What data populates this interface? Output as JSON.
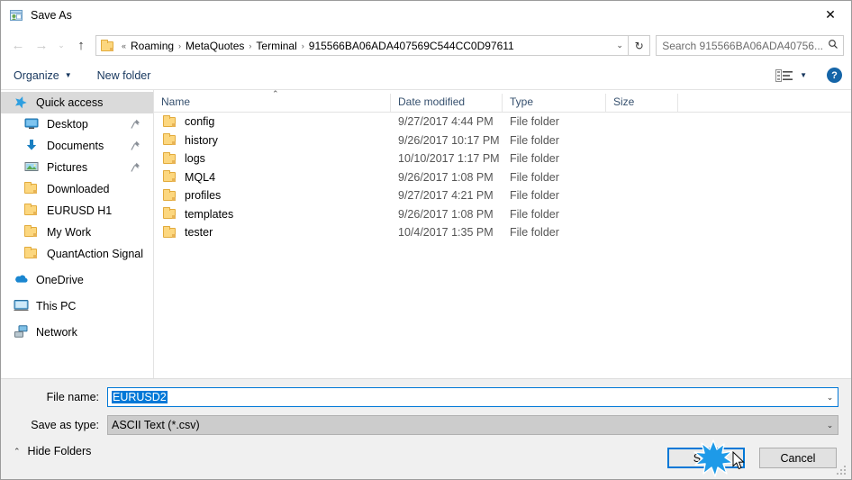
{
  "window": {
    "title": "Save As",
    "icon": "save-as-app-icon",
    "close_label": "✕"
  },
  "nav": {
    "back_icon": "←",
    "forward_icon": "→",
    "recent_icon": "⌄",
    "up_icon": "↑",
    "refresh_icon": "↻",
    "breadcrumb_prefix": "«",
    "breadcrumb_separator": "›",
    "crumbs": [
      "Roaming",
      "MetaQuotes",
      "Terminal",
      "915566BA06ADA407569C544CC0D97611"
    ],
    "address_chevron": "⌄"
  },
  "search": {
    "placeholder": "Search 915566BA06ADA40756...",
    "icon": "search-icon"
  },
  "commandbar": {
    "organize_label": "Organize",
    "organize_caret": "▼",
    "new_folder_label": "New folder",
    "view_caret": "▼",
    "help_label": "?"
  },
  "sidebar": {
    "items": [
      {
        "label": "Quick access",
        "icon": "star-icon",
        "selected": true,
        "indent": false,
        "pinned": false,
        "group": false
      },
      {
        "label": "Desktop",
        "icon": "monitor-icon",
        "selected": false,
        "indent": true,
        "pinned": true,
        "group": false
      },
      {
        "label": "Documents",
        "icon": "download-icon",
        "selected": false,
        "indent": true,
        "pinned": true,
        "group": false
      },
      {
        "label": "Pictures",
        "icon": "picture-icon",
        "selected": false,
        "indent": true,
        "pinned": true,
        "group": false
      },
      {
        "label": "Downloaded",
        "icon": "folder-icon",
        "selected": false,
        "indent": true,
        "pinned": false,
        "group": false
      },
      {
        "label": "EURUSD H1",
        "icon": "folder-icon",
        "selected": false,
        "indent": true,
        "pinned": false,
        "group": false
      },
      {
        "label": "My Work",
        "icon": "folder-icon",
        "selected": false,
        "indent": true,
        "pinned": false,
        "group": false
      },
      {
        "label": "QuantAction Signal",
        "icon": "folder-icon",
        "selected": false,
        "indent": true,
        "pinned": false,
        "group": false
      },
      {
        "label": "OneDrive",
        "icon": "cloud-icon",
        "selected": false,
        "indent": false,
        "pinned": false,
        "group": true
      },
      {
        "label": "This PC",
        "icon": "pc-icon",
        "selected": false,
        "indent": false,
        "pinned": false,
        "group": true
      },
      {
        "label": "Network",
        "icon": "network-icon",
        "selected": false,
        "indent": false,
        "pinned": false,
        "group": true
      }
    ]
  },
  "filelist": {
    "sort_indicator": "⌃",
    "columns": [
      "Name",
      "Date modified",
      "Type",
      "Size"
    ],
    "rows": [
      {
        "name": "config",
        "date": "9/27/2017 4:44 PM",
        "type": "File folder",
        "size": ""
      },
      {
        "name": "history",
        "date": "9/26/2017 10:17 PM",
        "type": "File folder",
        "size": ""
      },
      {
        "name": "logs",
        "date": "10/10/2017 1:17 PM",
        "type": "File folder",
        "size": ""
      },
      {
        "name": "MQL4",
        "date": "9/26/2017 1:08 PM",
        "type": "File folder",
        "size": ""
      },
      {
        "name": "profiles",
        "date": "9/27/2017 4:21 PM",
        "type": "File folder",
        "size": ""
      },
      {
        "name": "templates",
        "date": "9/26/2017 1:08 PM",
        "type": "File folder",
        "size": ""
      },
      {
        "name": "tester",
        "date": "10/4/2017 1:35 PM",
        "type": "File folder",
        "size": ""
      }
    ]
  },
  "bottom": {
    "filename_label": "File name:",
    "filename_value": "EURUSD2",
    "filetype_label": "Save as type:",
    "filetype_value": "ASCII Text (*.csv)",
    "combo_arrow": "⌄",
    "hide_folders_label": "Hide Folders",
    "hide_folders_caret": "⌃",
    "save_label": "Save",
    "cancel_label": "Cancel"
  },
  "colors": {
    "accent": "#0078d7",
    "selection": "#0078d7",
    "link_text": "#17375e",
    "folder_yellow": "#fcd77f",
    "sidebar_selected": "#dadada",
    "dialog_bg": "#f0f0f0"
  }
}
